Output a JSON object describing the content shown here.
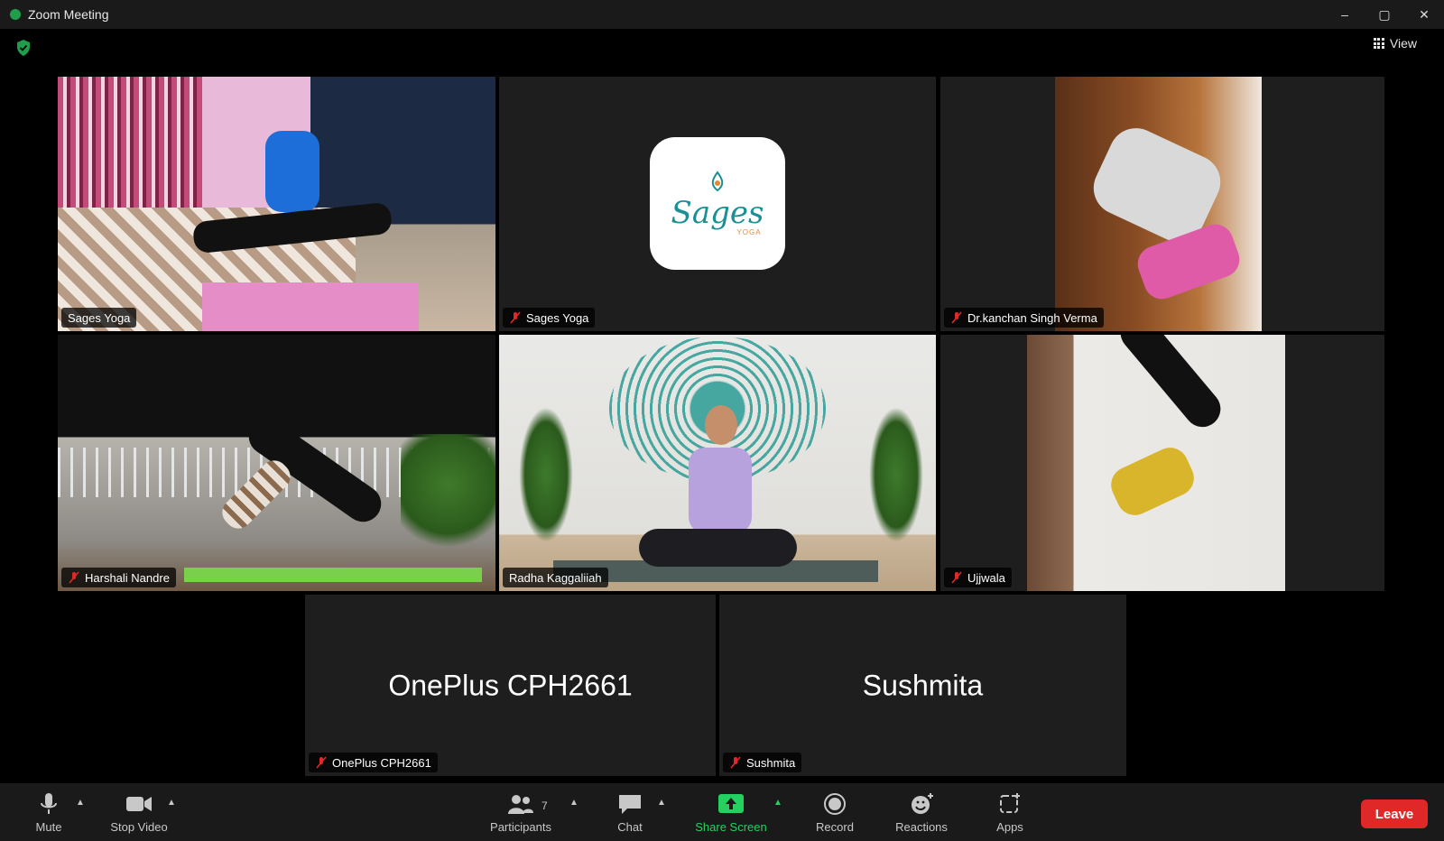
{
  "window": {
    "title": "Zoom Meeting",
    "minimize": "–",
    "maximize": "▢",
    "close": "✕"
  },
  "view": {
    "label": "View"
  },
  "tiles": [
    {
      "name": "Sages Yoga",
      "muted": false
    },
    {
      "name": "Sages Yoga",
      "muted": true
    },
    {
      "name": "Dr.kanchan Singh Verma",
      "muted": true
    },
    {
      "name": "Harshali Nandre",
      "muted": true
    },
    {
      "name": "Radha Kaggaliiah",
      "muted": false,
      "active": true
    },
    {
      "name": "Ujjwala",
      "muted": true
    },
    {
      "name": "OnePlus CPH2661",
      "muted": true,
      "display_name": "OnePlus CPH2661"
    },
    {
      "name": "Sushmita",
      "muted": true,
      "display_name": "Sushmita"
    }
  ],
  "logo": {
    "text": "Sages",
    "sub": "YOGA"
  },
  "toolbar": {
    "mute": "Mute",
    "stop_video": "Stop Video",
    "participants": "Participants",
    "participants_count": "7",
    "chat": "Chat",
    "share_screen": "Share Screen",
    "record": "Record",
    "reactions": "Reactions",
    "apps": "Apps",
    "leave": "Leave"
  },
  "colors": {
    "active_speaker": "#23d160",
    "leave": "#e02828",
    "share": "#23d160"
  }
}
